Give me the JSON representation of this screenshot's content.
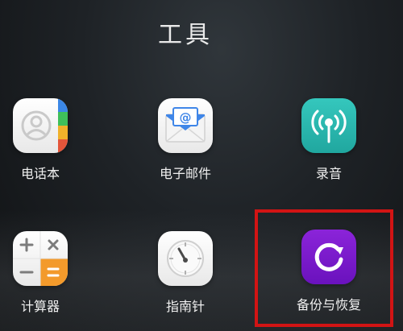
{
  "folder": {
    "title": "工具"
  },
  "apps": [
    {
      "id": "contacts",
      "label": "电话本",
      "icon": "contacts-icon"
    },
    {
      "id": "email",
      "label": "电子邮件",
      "icon": "email-icon"
    },
    {
      "id": "recorder",
      "label": "录音",
      "icon": "recorder-icon"
    },
    {
      "id": "calculator",
      "label": "计算器",
      "icon": "calculator-icon"
    },
    {
      "id": "compass",
      "label": "指南针",
      "icon": "compass-icon"
    },
    {
      "id": "backup",
      "label": "备份与恢复",
      "icon": "backup-restore-icon"
    }
  ],
  "colors": {
    "highlight": "#d21414",
    "recorder": "#2bb8ae",
    "backup": "#7a1bcc",
    "email_blue": "#3f86e8",
    "calculator_orange": "#f39a2b",
    "contacts_tabs": [
      "#3b87e6",
      "#3fbf5a",
      "#f0b12a",
      "#e4553a"
    ]
  }
}
